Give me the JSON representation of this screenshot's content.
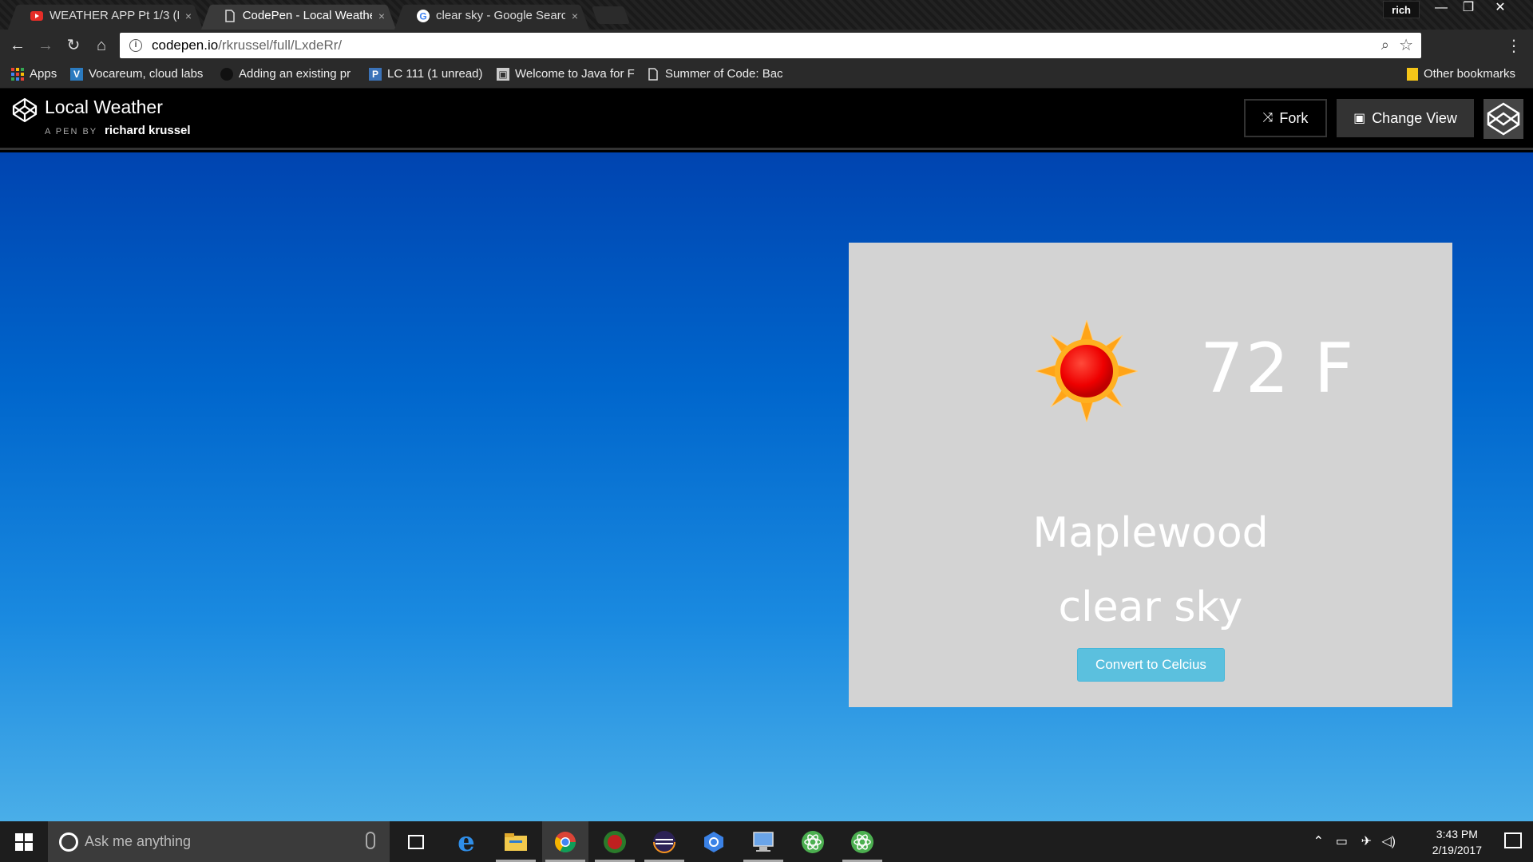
{
  "browser": {
    "tabs": [
      {
        "title": "WEATHER APP Pt 1/3 (Lo",
        "icon": "youtube-icon",
        "active": false
      },
      {
        "title": "CodePen - Local Weathe",
        "icon": "page-icon",
        "active": true
      },
      {
        "title": "clear sky - Google Search",
        "icon": "google-icon",
        "active": false
      }
    ],
    "close_glyph": "×",
    "profile": "rich",
    "url_host": "codepen.io",
    "url_path": "/rkrussel/full/LxdeRr/",
    "bookmarks": [
      {
        "label": "Apps",
        "icon": "apps-grid-icon"
      },
      {
        "label": "Vocareum, cloud labs",
        "icon": "vocareum-icon"
      },
      {
        "label": "Adding an existing pr",
        "icon": "github-icon"
      },
      {
        "label": "LC 111 (1 unread)",
        "icon": "p-icon"
      },
      {
        "label": "Welcome to Java for F",
        "icon": "bookmark-icon"
      },
      {
        "label": "Summer of Code: Bac",
        "icon": "page-icon"
      }
    ],
    "other_bookmarks": "Other bookmarks"
  },
  "codepen": {
    "title": "Local Weather",
    "by_label": "A PEN BY",
    "author": "richard krussel",
    "fork_label": "Fork",
    "change_view_label": "Change View"
  },
  "weather": {
    "temperature": "72 F",
    "city": "Maplewood",
    "description": "clear sky",
    "convert_label": "Convert to Celcius"
  },
  "taskbar": {
    "search_placeholder": "Ask me anything",
    "time": "3:43 PM",
    "date": "2/19/2017"
  }
}
